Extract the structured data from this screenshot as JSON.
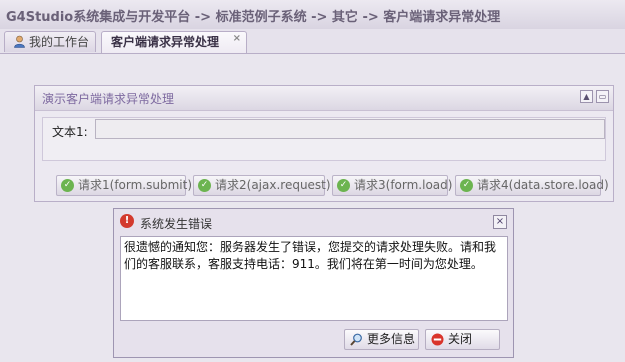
{
  "title_bar": {
    "breadcrumb": "G4Studio系统集成与开发平台 -> 标准范例子系统 -> 其它 -> 客户端请求异常处理"
  },
  "tabs": {
    "home_label": "我的工作台",
    "active_label": "客户端请求异常处理",
    "close_glyph": "×"
  },
  "panel": {
    "title": "演示客户端请求异常处理",
    "field_label": "文本1:",
    "field_value": "",
    "buttons": [
      "请求1(form.submit)",
      "请求2(ajax.request)",
      "请求3(form.load)",
      "请求4(data.store.load)"
    ]
  },
  "dialog": {
    "title": "系统发生错误",
    "message": "很遗憾的通知您：服务器发生了错误，您提交的请求处理失败。请和我们的客服联系，客服支持电话：911。我们将在第一时间为您处理。",
    "more_label": "更多信息",
    "close_label": "关闭"
  }
}
